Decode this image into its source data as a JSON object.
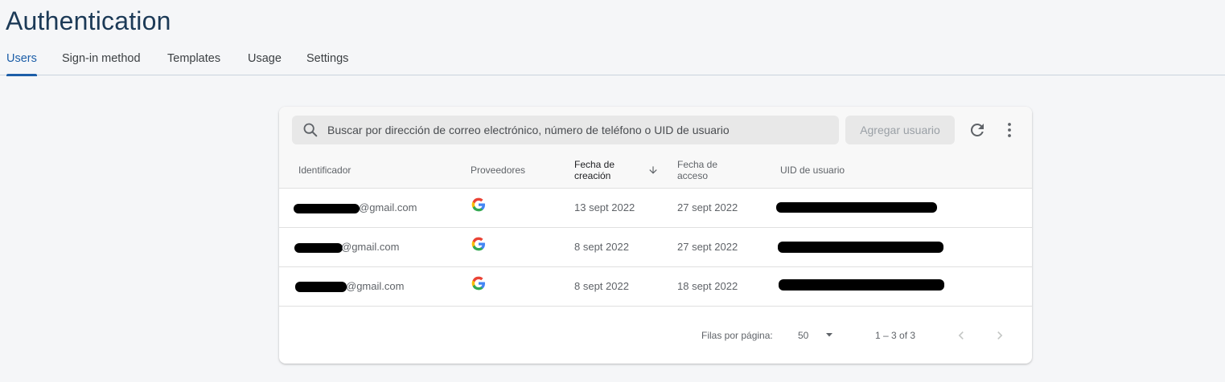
{
  "header": {
    "title": "Authentication"
  },
  "tabs": [
    {
      "label": "Users",
      "active": true
    },
    {
      "label": "Sign-in method"
    },
    {
      "label": "Templates"
    },
    {
      "label": "Usage"
    },
    {
      "label": "Settings"
    }
  ],
  "toolbar": {
    "search_placeholder": "Buscar por dirección de correo electrónico, número de teléfono o UID de usuario",
    "add_user_label": "Agregar usuario",
    "refresh_icon": "refresh-icon",
    "more_icon": "more-vert-icon"
  },
  "table": {
    "columns": {
      "identifier": "Identificador",
      "providers": "Proveedores",
      "created_l1": "Fecha de",
      "created_l2": "creación",
      "accessed_l1": "Fecha de",
      "accessed_l2": "acceso",
      "uid": "UID de usuario"
    },
    "rows": [
      {
        "email_suffix": "@gmail.com",
        "provider": "google",
        "created": "13 sept 2022",
        "accessed": "27 sept 2022"
      },
      {
        "email_suffix": "@gmail.com",
        "provider": "google",
        "created": "8 sept 2022",
        "accessed": "27 sept 2022"
      },
      {
        "email_suffix": "@gmail.com",
        "provider": "google",
        "created": "8 sept 2022",
        "accessed": "18 sept 2022"
      }
    ]
  },
  "pagination": {
    "rows_per_page_label": "Filas por página:",
    "rows_per_page_value": "50",
    "range": "1 – 3 of 3"
  },
  "colors": {
    "accent": "#1c5ea8",
    "title": "#1c3a57"
  }
}
